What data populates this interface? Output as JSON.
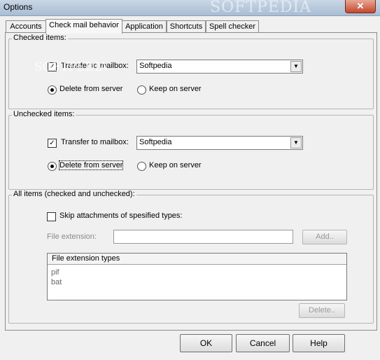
{
  "window": {
    "title": "Options",
    "watermark": "SOFTPEDIA",
    "close_glyph": "✕"
  },
  "tabs": [
    {
      "label": "Accounts"
    },
    {
      "label": "Check mail behavior",
      "active": true
    },
    {
      "label": "Application"
    },
    {
      "label": "Shortcuts"
    },
    {
      "label": "Spell checker"
    }
  ],
  "checked_items": {
    "legend": "Checked items:",
    "transfer_label": "Transfer to mailbox:",
    "transfer_checked": true,
    "mailbox": "Softpedia",
    "delete_label": "Delete from server",
    "keep_label": "Keep on server",
    "selected": "delete"
  },
  "unchecked_items": {
    "legend": "Unchecked items:",
    "transfer_label": "Transfer to mailbox:",
    "transfer_checked": true,
    "mailbox": "Softpedia",
    "delete_label": "Delete from server",
    "keep_label": "Keep on server",
    "selected": "delete"
  },
  "all_items": {
    "legend": "All items (checked and unchecked):",
    "skip_label": "Skip attachments of spesified types:",
    "skip_checked": false,
    "file_ext_label": "File extension:",
    "file_ext_value": "",
    "add_label": "Add..",
    "list_header": "File extension types",
    "list_items": [
      "pif",
      "bat"
    ],
    "delete_label": "Delete.."
  },
  "footer": {
    "ok": "OK",
    "cancel": "Cancel",
    "help": "Help"
  },
  "icons": {
    "check": "✓",
    "dropdown": "▼"
  }
}
